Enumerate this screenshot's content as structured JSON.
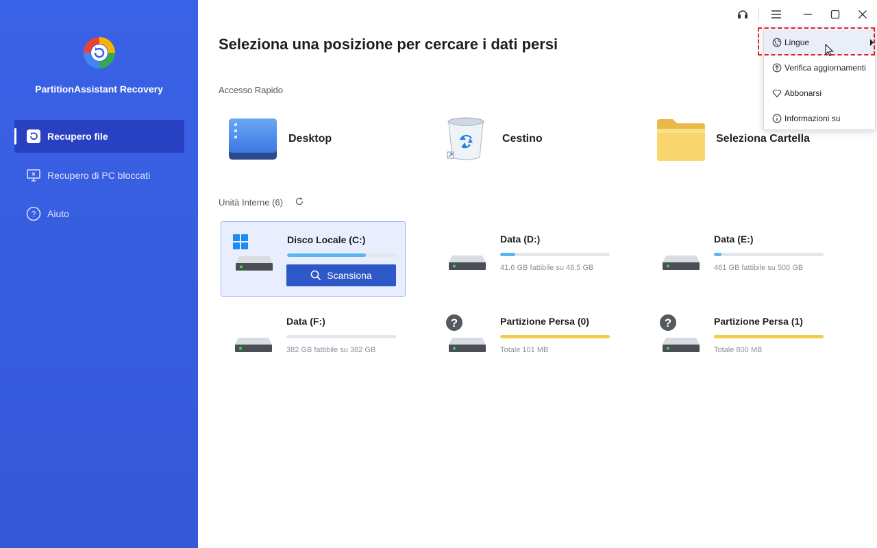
{
  "app": {
    "name": "PartitionAssistant Recovery"
  },
  "sidebar": {
    "items": [
      {
        "label": "Recupero file",
        "icon": "restore-file-icon",
        "active": true
      },
      {
        "label": "Recupero di PC bloccati",
        "icon": "monitor-icon",
        "active": false
      },
      {
        "label": "Aiuto",
        "icon": "help-icon",
        "active": false
      }
    ]
  },
  "header": {
    "title": "Seleziona una posizione per cercare i dati persi"
  },
  "quick_access": {
    "label": "Accesso Rapido",
    "items": [
      {
        "label": "Desktop",
        "icon": "desktop-icon"
      },
      {
        "label": "Cestino",
        "icon": "recycle-bin-icon"
      },
      {
        "label": "Seleziona Cartella",
        "icon": "folder-icon"
      }
    ]
  },
  "drives": {
    "label": "Unità Interne (6)",
    "items": [
      {
        "name": "Disco Locale (C:)",
        "usage_fraction": 0.72,
        "subtitle": "",
        "bar_color": "#5ab6ef",
        "selected": true,
        "system": true,
        "lost": false
      },
      {
        "name": "Data (D:)",
        "usage_fraction": 0.14,
        "subtitle": "41.6 GB fattibile su 48.5 GB",
        "bar_color": "#5ab6ef",
        "selected": false,
        "system": false,
        "lost": false
      },
      {
        "name": "Data (E:)",
        "usage_fraction": 0.07,
        "subtitle": "461 GB fattibile su 500 GB",
        "bar_color": "#5ab6ef",
        "selected": false,
        "system": false,
        "lost": false
      },
      {
        "name": "Data (F:)",
        "usage_fraction": 0.0,
        "subtitle": "382 GB fattibile su 382 GB",
        "bar_color": "#5ab6ef",
        "selected": false,
        "system": false,
        "lost": false
      },
      {
        "name": "Partizione Persa (0)",
        "usage_fraction": 1.0,
        "subtitle": "Totale 101 MB",
        "bar_color": "#f3cc4b",
        "selected": false,
        "system": false,
        "lost": true
      },
      {
        "name": "Partizione Persa (1)",
        "usage_fraction": 1.0,
        "subtitle": "Totale 800 MB",
        "bar_color": "#f3cc4b",
        "selected": false,
        "system": false,
        "lost": true
      }
    ],
    "scan_label": "Scansiona"
  },
  "menu": {
    "items": [
      {
        "label": "Lingue",
        "icon": "globe-icon"
      },
      {
        "label": "Verifica aggiornamenti",
        "icon": "update-icon"
      },
      {
        "label": "Abbonarsi",
        "icon": "diamond-icon"
      },
      {
        "label": "Informazioni su",
        "icon": "info-icon"
      }
    ]
  },
  "colors": {
    "sidebar": "#3558d8",
    "accent": "#2e58c8",
    "highlight": "#e01f26"
  }
}
